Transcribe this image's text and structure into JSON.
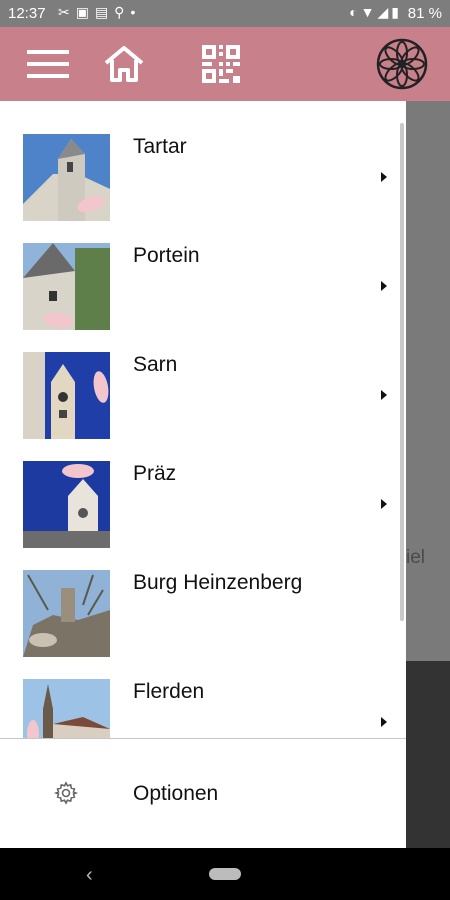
{
  "status": {
    "time": "12:37",
    "battery": "81 %"
  },
  "menu": [
    {
      "label": "Tartar"
    },
    {
      "label": "Portein"
    },
    {
      "label": "Sarn"
    },
    {
      "label": "Präz"
    },
    {
      "label": "Burg Heinzenberg"
    },
    {
      "label": "Flerden"
    }
  ],
  "options": {
    "label": "Optionen"
  },
  "background": {
    "text": "iel"
  },
  "colors": {
    "appbar": "#c8818b",
    "accent_leaf": "#f2c6cc"
  }
}
